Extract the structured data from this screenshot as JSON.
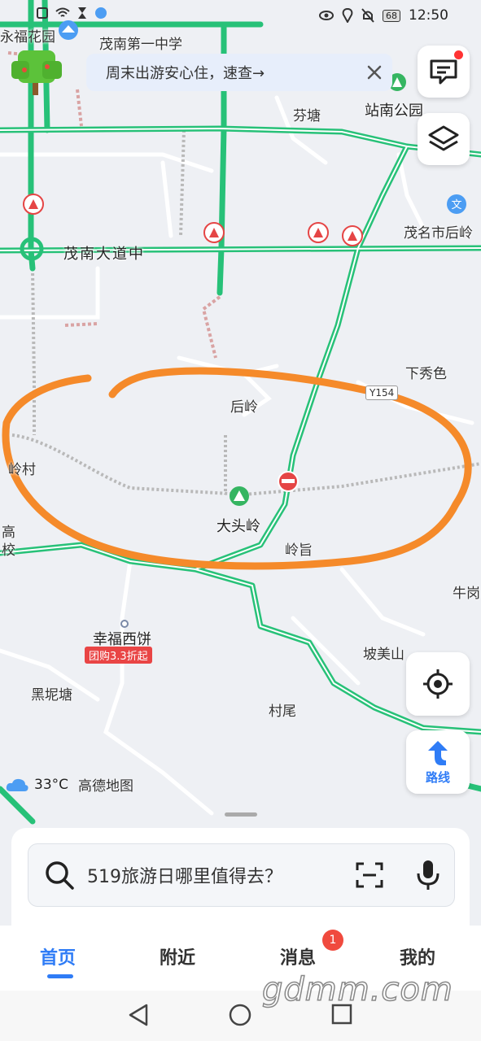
{
  "status_bar": {
    "time": "12:50",
    "battery": "68"
  },
  "banner": {
    "text": "周末出游安心住，速查→"
  },
  "map": {
    "places": {
      "yongfu": "永福花园",
      "school": "茂南第一中学",
      "fentang": "芬塘",
      "station_park": "站南公园",
      "dadao": "茂南大道中",
      "houling_north": "茂名市后岭",
      "xiaxiuse": "下秀色",
      "houling": "后岭",
      "lingcun": "岭村",
      "datouling": "大头岭",
      "lingzhi": "岭旨",
      "gao": "高",
      "xiao": "校",
      "niugang": "牛岗",
      "bakery": "幸福西饼",
      "bakery_deal": "团购3.3折起",
      "pomeishan": "坡美山",
      "heinitang": "黑坭塘",
      "cunwei": "村尾"
    },
    "road_tags": {
      "y154": "Y154"
    },
    "colors": {
      "highway_green": "#27c178",
      "annotation_orange": "#f58a2a",
      "accent_blue": "#2f7cf6"
    }
  },
  "controls": {
    "route_label": "路线",
    "weather_temp": "33°C",
    "brand": "高德地图"
  },
  "search": {
    "placeholder": "519旅游日哪里值得去？"
  },
  "tabs": {
    "home": "首页",
    "nearby": "附近",
    "messages": "消息",
    "mine": "我的",
    "messages_badge": "1"
  },
  "watermark": "gdmm.com",
  "icons": {
    "search": "search-icon",
    "scan": "scan-icon",
    "mic": "mic-icon",
    "message": "message-icon",
    "layers": "layers-icon",
    "locate": "locate-icon",
    "route": "route-arrow-icon",
    "close": "close-icon"
  }
}
